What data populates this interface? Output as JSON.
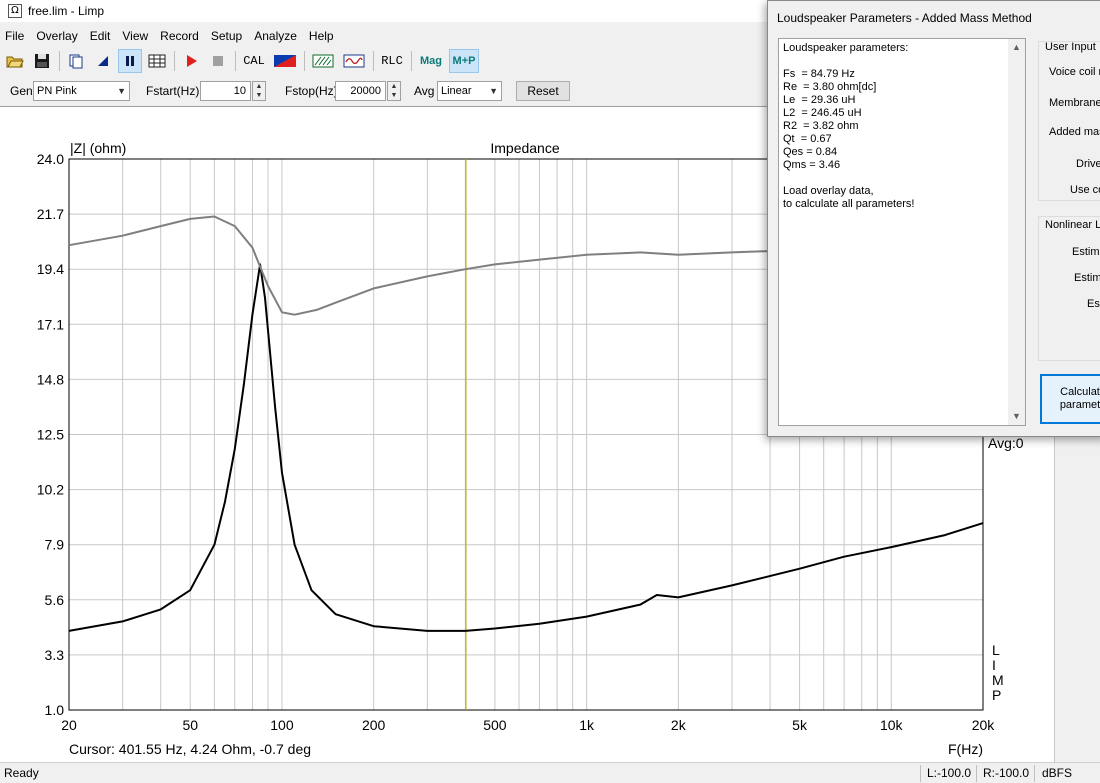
{
  "window": {
    "title": "free.lim - Limp",
    "icon": "omega-icon"
  },
  "menu": [
    "File",
    "Overlay",
    "Edit",
    "View",
    "Record",
    "Setup",
    "Analyze",
    "Help"
  ],
  "toolbar": {
    "cal": "CAL",
    "rlc": "RLC",
    "mag": "Mag",
    "mp": "M+P"
  },
  "controls": {
    "gen_label": "Gen",
    "gen_value": "PN Pink",
    "fstart_label": "Fstart(Hz)",
    "fstart_value": "10",
    "fstop_label": "Fstop(Hz)",
    "fstop_value": "20000",
    "avg_label": "Avg",
    "avg_value": "Linear",
    "reset": "Reset"
  },
  "plot": {
    "cursor_text": "Cursor: 401.55 Hz, 4.24 Ohm, -0.7 deg",
    "avg_text": "Avg:0",
    "limp_letters": [
      "L",
      "I",
      "M",
      "P"
    ]
  },
  "chart_data": {
    "type": "line",
    "title": "Impedance",
    "ylabel": "|Z| (ohm)",
    "xlabel": "F(Hz)",
    "x_scale": "log",
    "xlim": [
      20,
      20000
    ],
    "ylim": [
      1.0,
      24.0
    ],
    "x_ticks": [
      20,
      50,
      100,
      200,
      500,
      1000,
      2000,
      5000,
      10000,
      20000
    ],
    "x_tick_labels": [
      "20",
      "50",
      "100",
      "200",
      "500",
      "1k",
      "2k",
      "5k",
      "10k",
      "20k"
    ],
    "y_ticks": [
      1.0,
      3.3,
      5.6,
      7.9,
      10.2,
      12.5,
      14.8,
      17.1,
      19.4,
      21.7,
      24.0
    ],
    "y_tick_labels": [
      "1.0",
      "3.3",
      "5.6",
      "7.9",
      "10.2",
      "12.5",
      "14.8",
      "17.1",
      "19.4",
      "21.7",
      "24.0"
    ],
    "grid": true,
    "cursor_x": 401.55,
    "series": [
      {
        "color": "#000000",
        "x": [
          20,
          30,
          40,
          50,
          60,
          65,
          70,
          75,
          80,
          84.79,
          88,
          95,
          100,
          110,
          125,
          150,
          200,
          300,
          400,
          500,
          700,
          1000,
          1500,
          1700,
          2000,
          3000,
          5000,
          7000,
          10000,
          15000,
          20000
        ],
        "y": [
          4.3,
          4.7,
          5.2,
          6.0,
          7.9,
          9.7,
          11.9,
          14.6,
          17.5,
          19.6,
          18.2,
          13.6,
          10.9,
          7.9,
          6.0,
          5.0,
          4.5,
          4.3,
          4.3,
          4.4,
          4.6,
          4.9,
          5.4,
          5.8,
          5.7,
          6.2,
          6.9,
          7.4,
          7.8,
          8.3,
          8.8
        ]
      },
      {
        "color": "#7f7f7f",
        "x": [
          20,
          30,
          40,
          50,
          60,
          70,
          80,
          90,
          100,
          110,
          130,
          150,
          200,
          300,
          400,
          500,
          700,
          1000,
          1500,
          2000,
          3000,
          5000,
          7000
        ],
        "y": [
          20.4,
          20.8,
          21.2,
          21.5,
          21.6,
          21.2,
          20.3,
          18.7,
          17.6,
          17.5,
          17.7,
          18.0,
          18.6,
          19.1,
          19.4,
          19.6,
          19.8,
          20.0,
          20.1,
          20.0,
          20.1,
          20.2,
          20.2
        ]
      }
    ]
  },
  "dialog": {
    "title": "Loudspeaker Parameters - Added Mass Method",
    "lines": [
      "Loudspeaker parameters:",
      "",
      "Fs  = 84.79 Hz",
      "Re  = 3.80 ohm[dc]",
      "Le  = 29.36 uH",
      "L2  = 246.45 uH",
      "R2  = 3.82 ohm",
      "Qt  = 0.67",
      "Qes = 0.84",
      "Qms = 3.46",
      "",
      "Load overlay data,",
      "to calculate all parameters!"
    ],
    "user_input": "User Input",
    "voice_coil": "Voice coil re",
    "membrane": "Membrane",
    "added_mass": "Added mas",
    "driver": "Drive",
    "use": "Use co",
    "nonlinear": "Nonlinear LS",
    "estim1": "Estima",
    "estim2": "Estim",
    "estim3": "Est",
    "calc_line1": "Calculat",
    "calc_line2": "paramet"
  },
  "status": {
    "ready": "Ready",
    "left": "L:-100.0",
    "right": "R:-100.0",
    "unit": "dBFS"
  }
}
